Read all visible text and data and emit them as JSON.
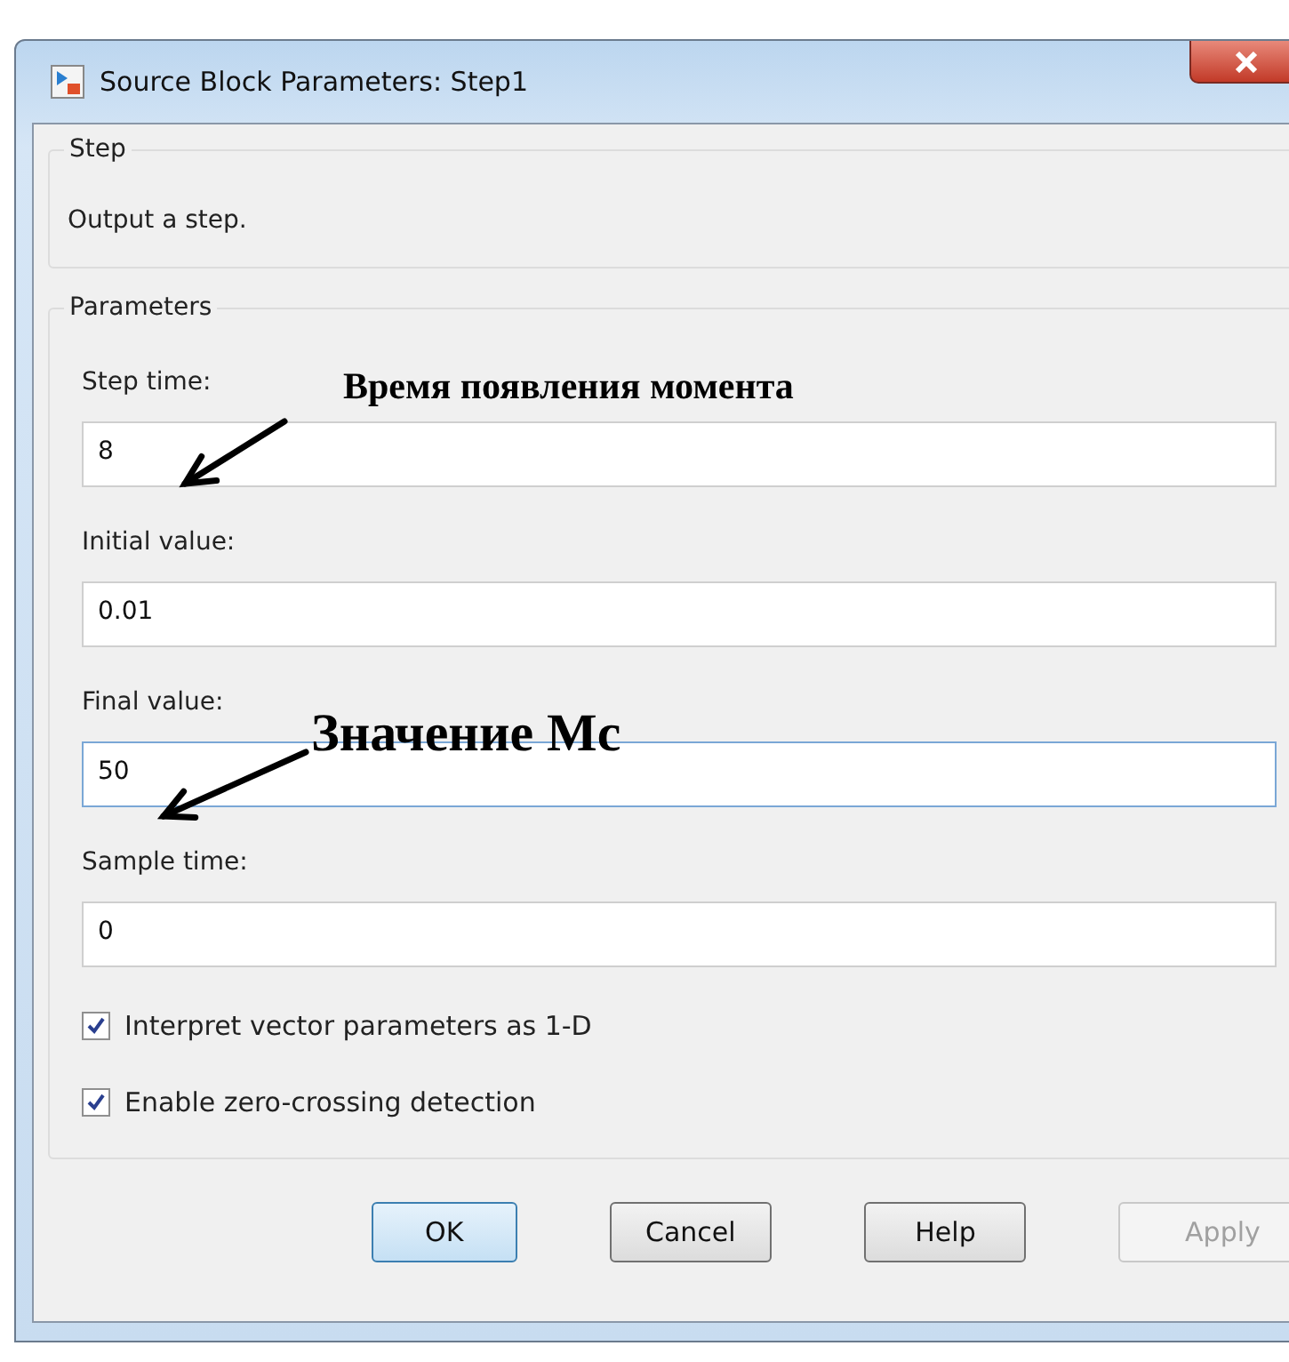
{
  "window": {
    "title": "Source Block Parameters: Step1"
  },
  "step_group": {
    "title": "Step",
    "description": "Output a step."
  },
  "parameters_group": {
    "title": "Parameters",
    "fields": [
      {
        "label": "Step time:",
        "value": "8",
        "focused": false
      },
      {
        "label": "Initial value:",
        "value": "0.01",
        "focused": false
      },
      {
        "label": "Final value:",
        "value": "50",
        "focused": true
      },
      {
        "label": "Sample time:",
        "value": "0",
        "focused": false
      }
    ],
    "checkboxes": [
      {
        "label": "Interpret vector parameters as 1-D",
        "checked": true
      },
      {
        "label": "Enable zero-crossing detection",
        "checked": true
      }
    ]
  },
  "annotations": [
    {
      "text": "Время появления момента"
    },
    {
      "text": "Значение Mc"
    }
  ],
  "buttons": [
    {
      "label": "OK",
      "default": true,
      "disabled": false
    },
    {
      "label": "Cancel",
      "default": false,
      "disabled": false
    },
    {
      "label": "Help",
      "default": false,
      "disabled": false
    },
    {
      "label": "Apply",
      "default": false,
      "disabled": true
    }
  ]
}
